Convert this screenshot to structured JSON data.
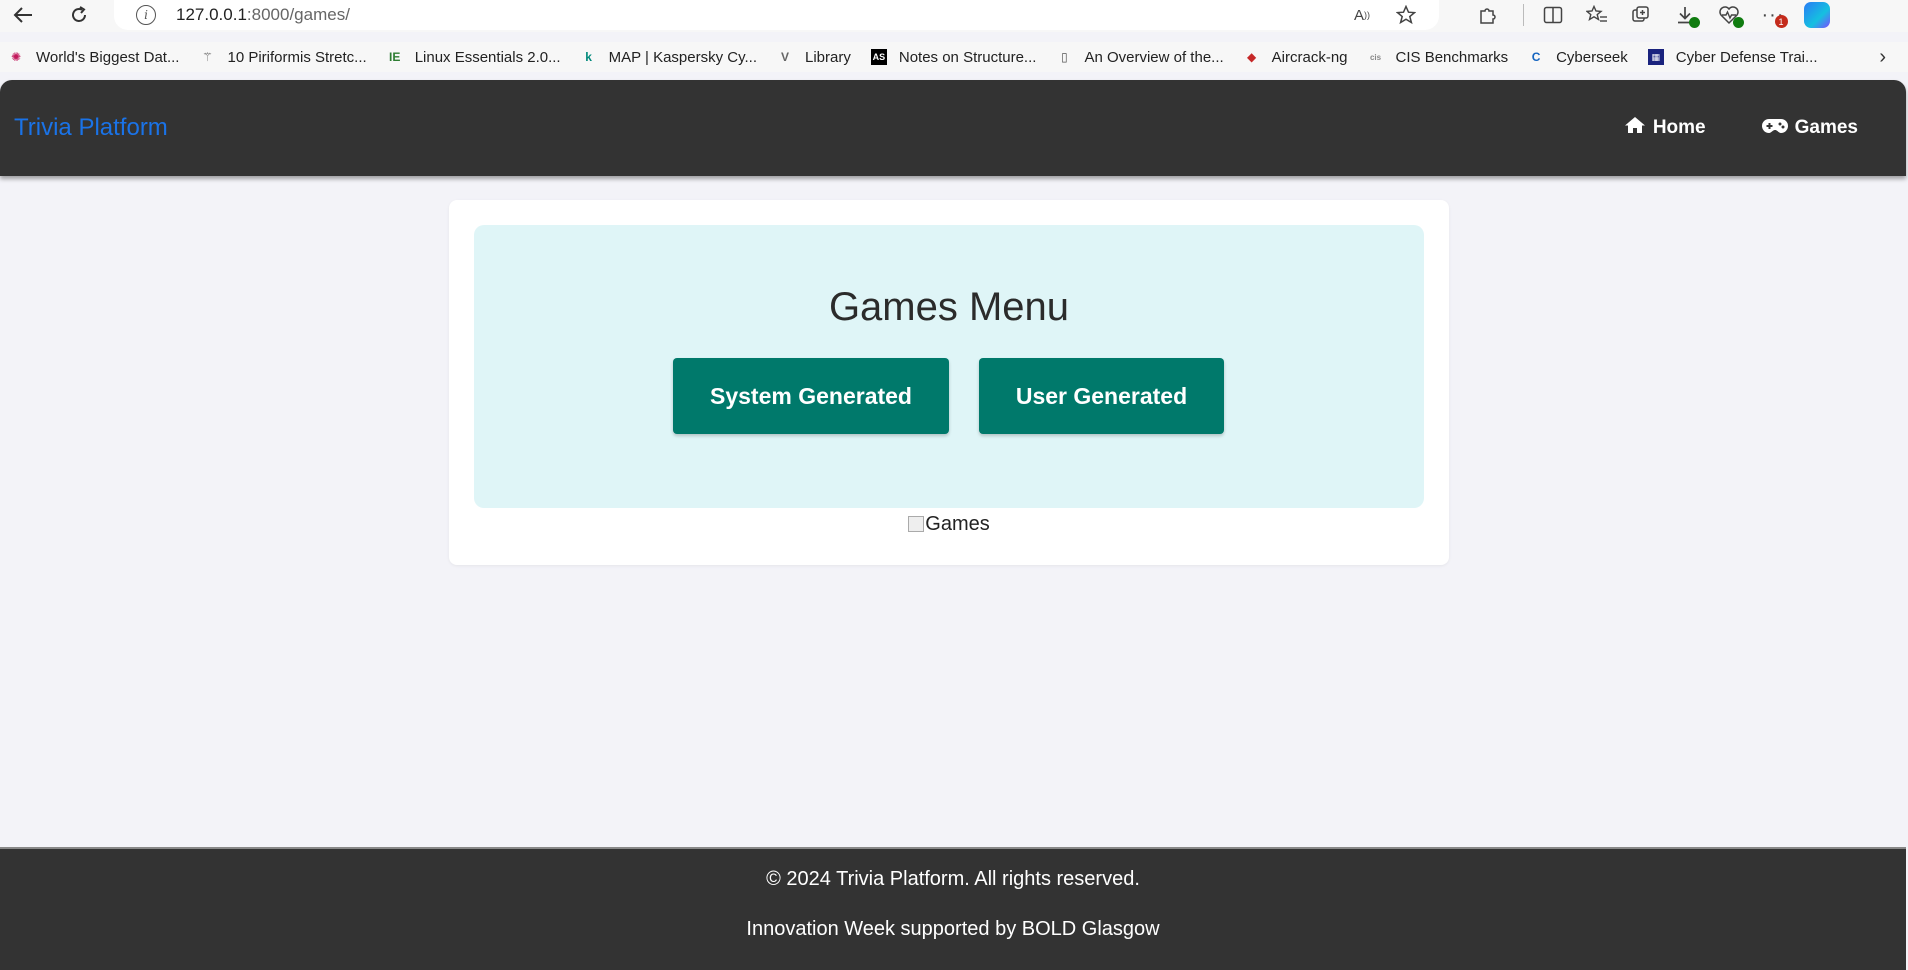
{
  "browser": {
    "url_host": "127.0.0.1",
    "url_rest": ":8000/games/",
    "bookmarks": [
      {
        "label": "World's Biggest Dat...",
        "icon": "data-icon",
        "color": "#c2185b"
      },
      {
        "label": "10 Piriformis Stretc...",
        "icon": "caduceus-icon",
        "color": "#555555"
      },
      {
        "label": "Linux Essentials 2.0...",
        "icon": "ie-logo-icon",
        "color": "#2e7d32"
      },
      {
        "label": "MAP | Kaspersky Cy...",
        "icon": "kaspersky-icon",
        "color": "#00897b"
      },
      {
        "label": "Library",
        "icon": "library-icon",
        "color": "#666666"
      },
      {
        "label": "Notes on Structure...",
        "icon": "as-icon",
        "color": "#000000"
      },
      {
        "label": "An Overview of the...",
        "icon": "document-icon",
        "color": "#555555"
      },
      {
        "label": "Aircrack-ng",
        "icon": "aircrack-icon",
        "color": "#c62828"
      },
      {
        "label": "CIS Benchmarks",
        "icon": "cis-icon",
        "color": "#888888"
      },
      {
        "label": "Cyberseek",
        "icon": "cyberseek-icon",
        "color": "#1565c0"
      },
      {
        "label": "Cyber Defense Trai...",
        "icon": "sans-icon",
        "color": "#1a237e"
      }
    ],
    "download_badge": "1"
  },
  "navbar": {
    "brand": "Trivia Platform",
    "links": [
      {
        "label": "Home",
        "icon": "home-icon"
      },
      {
        "label": "Games",
        "icon": "gamepad-icon"
      }
    ]
  },
  "main": {
    "title": "Games Menu",
    "buttons": {
      "system": "System Generated",
      "user": "User Generated"
    },
    "image_alt": "Games"
  },
  "footer": {
    "copyright": "© 2024 Trivia Platform. All rights reserved.",
    "support": "Innovation Week supported by BOLD Glasgow"
  },
  "colors": {
    "brand": "#1a73e8",
    "navbar_bg": "#333333",
    "button_bg": "#00796b",
    "menu_bg": "#dff5f7",
    "page_bg": "#f3f3f8"
  }
}
